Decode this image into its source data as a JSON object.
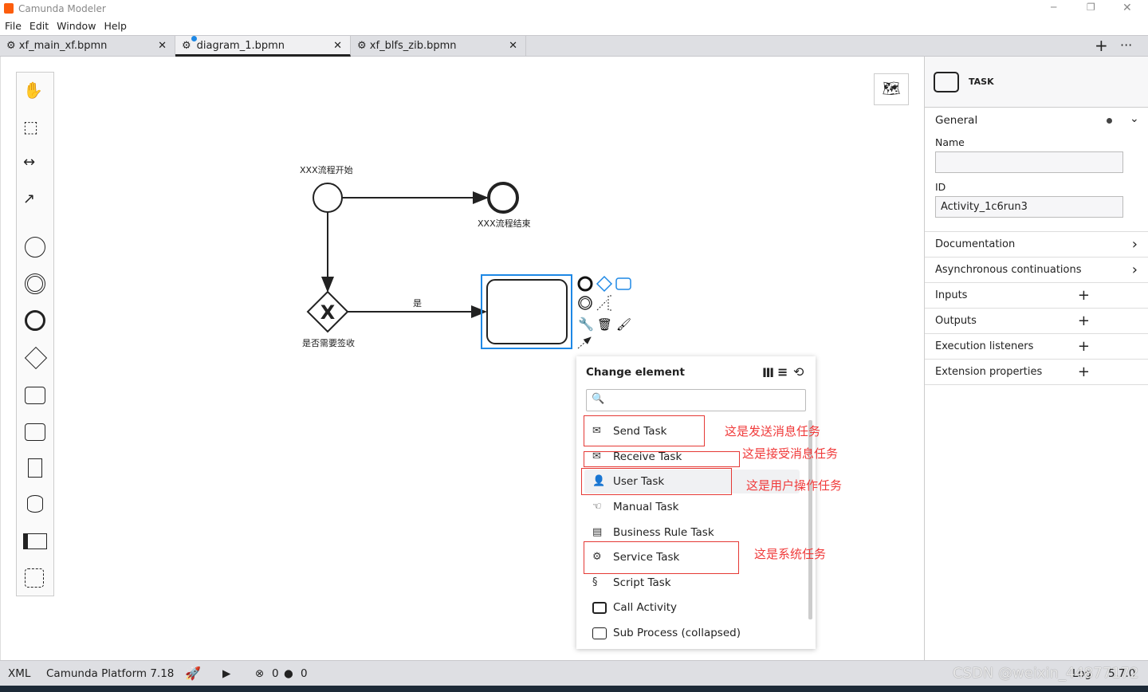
{
  "window": {
    "title": "Camunda Modeler",
    "minimize": "─",
    "restore": "❐",
    "close": "✕"
  },
  "menu": [
    "File",
    "Edit",
    "Window",
    "Help"
  ],
  "tabs": [
    {
      "label": "xf_main_xf.bpmn",
      "active": false
    },
    {
      "label": "diagram_1.bpmn",
      "active": true,
      "unsaved": true
    },
    {
      "label": "xf_blfs_zib.bpmn",
      "active": false
    }
  ],
  "tab_actions": {
    "add": "+",
    "more": "···"
  },
  "diagram": {
    "start_label": "XXX流程开始",
    "end_label": "XXX流程结束",
    "gateway_label": "是否需要签收",
    "flow_label": "是"
  },
  "popup": {
    "title": "Change element",
    "search_placeholder": "",
    "items": [
      {
        "label": "Send Task",
        "icon": "envelope-filled-icon"
      },
      {
        "label": "Receive Task",
        "icon": "envelope-outline-icon"
      },
      {
        "label": "User Task",
        "icon": "user-icon",
        "hovered": true
      },
      {
        "label": "Manual Task",
        "icon": "hand-icon"
      },
      {
        "label": "Business Rule Task",
        "icon": "table-icon"
      },
      {
        "label": "Service Task",
        "icon": "gear-icon"
      },
      {
        "label": "Script Task",
        "icon": "script-icon"
      },
      {
        "label": "Call Activity",
        "icon": "call-activity-icon"
      },
      {
        "label": "Sub Process (collapsed)",
        "icon": "subprocess-icon"
      }
    ]
  },
  "annotations": [
    "这是发送消息任务",
    "这是接受消息任务",
    "这是用户操作任务",
    "这是系统任务"
  ],
  "properties": {
    "element_type": "TASK",
    "general": "General",
    "name_label": "Name",
    "name_value": "",
    "id_label": "ID",
    "id_value": "Activity_1c6run3",
    "sections": [
      {
        "label": "Documentation",
        "action": "›"
      },
      {
        "label": "Asynchronous continuations",
        "action": "›"
      },
      {
        "label": "Inputs",
        "action": "+"
      },
      {
        "label": "Outputs",
        "action": "+"
      },
      {
        "label": "Execution listeners",
        "action": "+"
      },
      {
        "label": "Extension properties",
        "action": "+"
      }
    ]
  },
  "status": {
    "xml": "XML",
    "platform": "Camunda Platform 7.18",
    "errors": "0",
    "warnings": "0",
    "log": "Log",
    "version": "5.7.0",
    "watermark": "CSDN @weixin_44877172"
  },
  "colors": {
    "selection": "#1e88e5",
    "annotation": "#e53935",
    "brand": "#fc5d0d"
  }
}
